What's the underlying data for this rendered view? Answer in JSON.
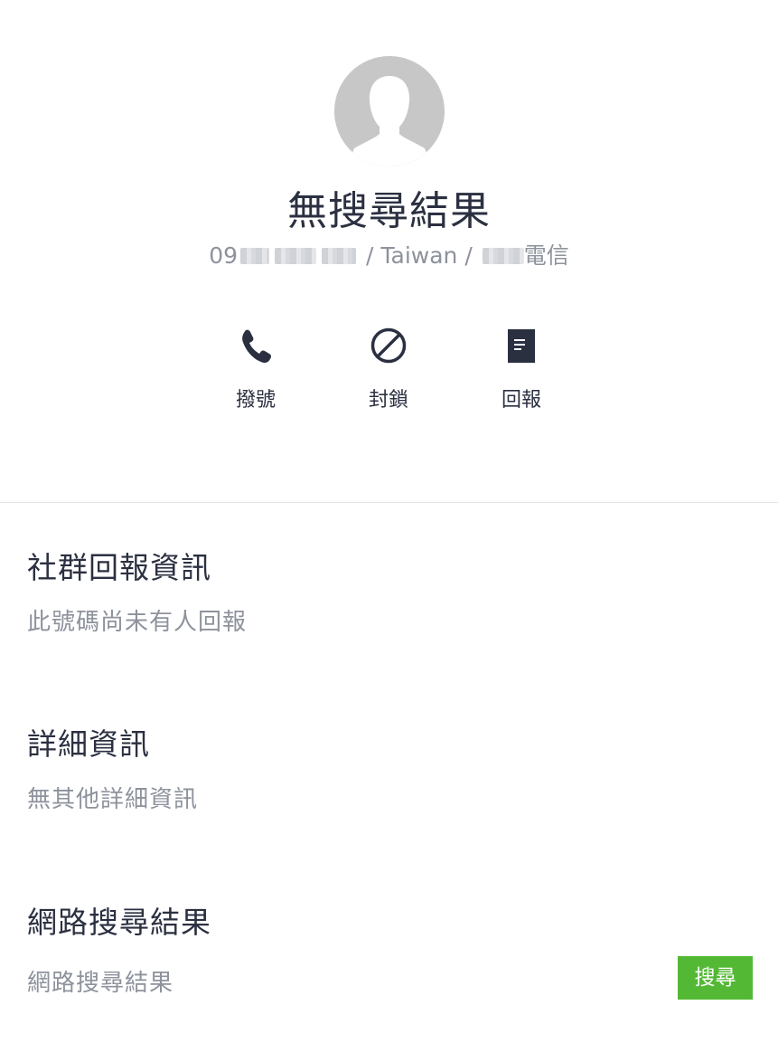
{
  "profile": {
    "title": "無搜尋結果",
    "phone_prefix": "09",
    "country": "Taiwan",
    "separator": "/",
    "carrier_suffix": "電信"
  },
  "actions": [
    {
      "label": "撥號",
      "icon": "phone-icon"
    },
    {
      "label": "封鎖",
      "icon": "block-icon"
    },
    {
      "label": "回報",
      "icon": "report-document-icon"
    }
  ],
  "sections": {
    "community": {
      "title": "社群回報資訊",
      "body": "此號碼尚未有人回報"
    },
    "details": {
      "title": "詳細資訊",
      "body": "無其他詳細資訊"
    },
    "web": {
      "title": "網路搜尋結果",
      "body": "網路搜尋結果",
      "button_label": "搜尋"
    }
  },
  "colors": {
    "text_primary": "#2b3041",
    "text_secondary": "#8d929c",
    "avatar_bg": "#c7c7c7",
    "accent_green": "#53b935"
  }
}
